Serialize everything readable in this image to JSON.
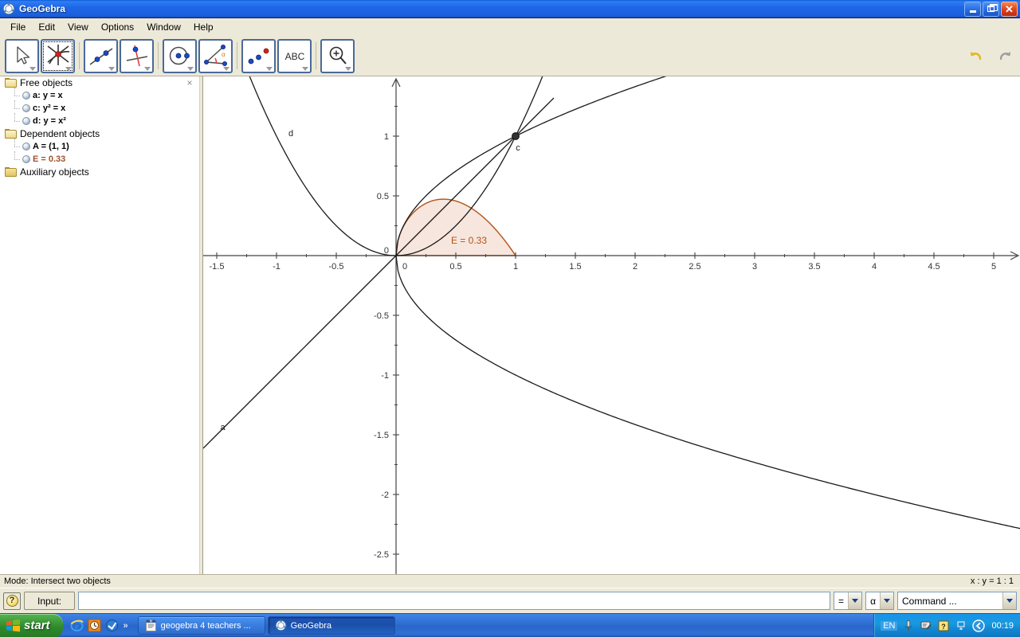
{
  "window": {
    "title": "GeoGebra",
    "icon": "geogebra-logo-icon",
    "minimize": "Minimize",
    "maximize": "Restore",
    "close": "Close"
  },
  "menubar": {
    "items": [
      {
        "label": "File"
      },
      {
        "label": "Edit"
      },
      {
        "label": "View"
      },
      {
        "label": "Options"
      },
      {
        "label": "Window"
      },
      {
        "label": "Help"
      }
    ]
  },
  "toolbar": {
    "buttons": [
      {
        "name": "move-tool",
        "icon": "arrow-cursor-icon",
        "selected": false
      },
      {
        "name": "intersect-tool",
        "icon": "intersect-two-objects-icon",
        "selected": true
      },
      {
        "name": "line-tool",
        "icon": "line-through-two-points-icon",
        "selected": false
      },
      {
        "name": "perpendicular-line-tool",
        "icon": "perpendicular-line-icon",
        "selected": false
      },
      {
        "name": "circle-tool",
        "icon": "circle-center-point-icon",
        "selected": false
      },
      {
        "name": "angle-tool",
        "icon": "angle-icon",
        "selected": false
      },
      {
        "name": "reflect-tool",
        "icon": "reflect-object-icon",
        "selected": false
      },
      {
        "name": "text-tool",
        "icon": "abc-text-icon",
        "label": "ABC",
        "selected": false
      },
      {
        "name": "zoom-in-tool",
        "icon": "magnifier-zoom-in-icon",
        "selected": false
      }
    ],
    "undo": "undo-arrow-icon",
    "redo": "redo-arrow-icon"
  },
  "algebra": {
    "close": "×",
    "groups": [
      {
        "title": "Free objects",
        "open": true,
        "items": [
          {
            "label": "a: y = x",
            "accent": false
          },
          {
            "label": "c: y² = x",
            "accent": false
          },
          {
            "label": "d: y = x²",
            "accent": false
          }
        ]
      },
      {
        "title": "Dependent objects",
        "open": true,
        "items": [
          {
            "label": "A = (1, 1)",
            "accent": false
          },
          {
            "label": "E = 0.33",
            "accent": true
          }
        ]
      },
      {
        "title": "Auxiliary objects",
        "open": false,
        "items": []
      }
    ]
  },
  "statusbar": {
    "mode": "Mode: Intersect two objects",
    "ratio": "x : y = 1 : 1"
  },
  "inputbar": {
    "help": "?",
    "input_label": "Input:",
    "input_value": "",
    "input_placeholder": "",
    "symbol_equals": "=",
    "symbol_alpha": "α",
    "command_value": "Command ..."
  },
  "taskbar": {
    "start": "start",
    "quicklaunch": [
      {
        "name": "internet-explorer-icon"
      },
      {
        "name": "clock-icon"
      },
      {
        "name": "outlook-icon"
      }
    ],
    "more": "»",
    "tasks": [
      {
        "label": "geogebra 4 teachers ...",
        "icon": "word-document-icon",
        "active": false
      },
      {
        "label": "GeoGebra",
        "icon": "geogebra-logo-icon",
        "active": true
      }
    ],
    "tray": {
      "language": "EN",
      "icons": [
        "microphone-icon",
        "handwriting-pen-icon",
        "help-note-icon",
        "window-small-icon",
        "show-hidden-icons-icon"
      ],
      "clock": "00:19"
    }
  },
  "chart_data": {
    "type": "line",
    "title": "",
    "xlabel": "",
    "ylabel": "",
    "xlim": [
      -1.62,
      5.22
    ],
    "ylim": [
      -2.66,
      1.4
    ],
    "grid": false,
    "legend": false,
    "axis_ticks": {
      "x_major": [
        -1.5,
        -1,
        -0.5,
        0,
        0.5,
        1,
        1.5,
        2,
        2.5,
        3,
        3.5,
        4,
        4.5,
        5
      ],
      "x_labels": [
        "-1.5",
        "-1",
        "-0.5",
        "0",
        "0.5",
        "1",
        "1.5",
        "2",
        "2.5",
        "3",
        "3.5",
        "4",
        "4.5",
        "5"
      ],
      "y_major": [
        1,
        0.5,
        0,
        -0.5,
        -1,
        -1.5,
        -2,
        -2.5
      ],
      "y_labels": [
        "1",
        "0.5",
        "0",
        "-0.5",
        "-1",
        "-1.5",
        "-2",
        "-2.5"
      ],
      "minor_step": 0.25
    },
    "series": [
      {
        "name": "a",
        "label": "a",
        "equation": "y = x",
        "color": "#1a1a1a",
        "label_xy": [
          -1.45,
          -1.46
        ]
      },
      {
        "name": "c-upper",
        "label": "c",
        "equation": "y = sqrt(x)",
        "color": "#1a1a1a",
        "label_xy": [
          1.02,
          0.88
        ]
      },
      {
        "name": "c-lower",
        "label": "",
        "equation": "y = -sqrt(x)",
        "color": "#1a1a1a",
        "label_xy": null
      },
      {
        "name": "d",
        "label": "d",
        "equation": "y = x^2",
        "color": "#1a1a1a",
        "label_xy": [
          -0.88,
          1.0
        ]
      }
    ],
    "points": [
      {
        "name": "A",
        "label": "",
        "x": 1,
        "y": 1,
        "color": "#333333"
      }
    ],
    "region": {
      "name": "E",
      "label": "E = 0.33",
      "value": 0.33,
      "from": 0,
      "to": 1,
      "upper": "sqrt(x)",
      "lower": "x^2",
      "fill": "#f7e6dd",
      "stroke": "#b4521a",
      "label_xy": [
        0.45,
        0.1
      ]
    }
  }
}
